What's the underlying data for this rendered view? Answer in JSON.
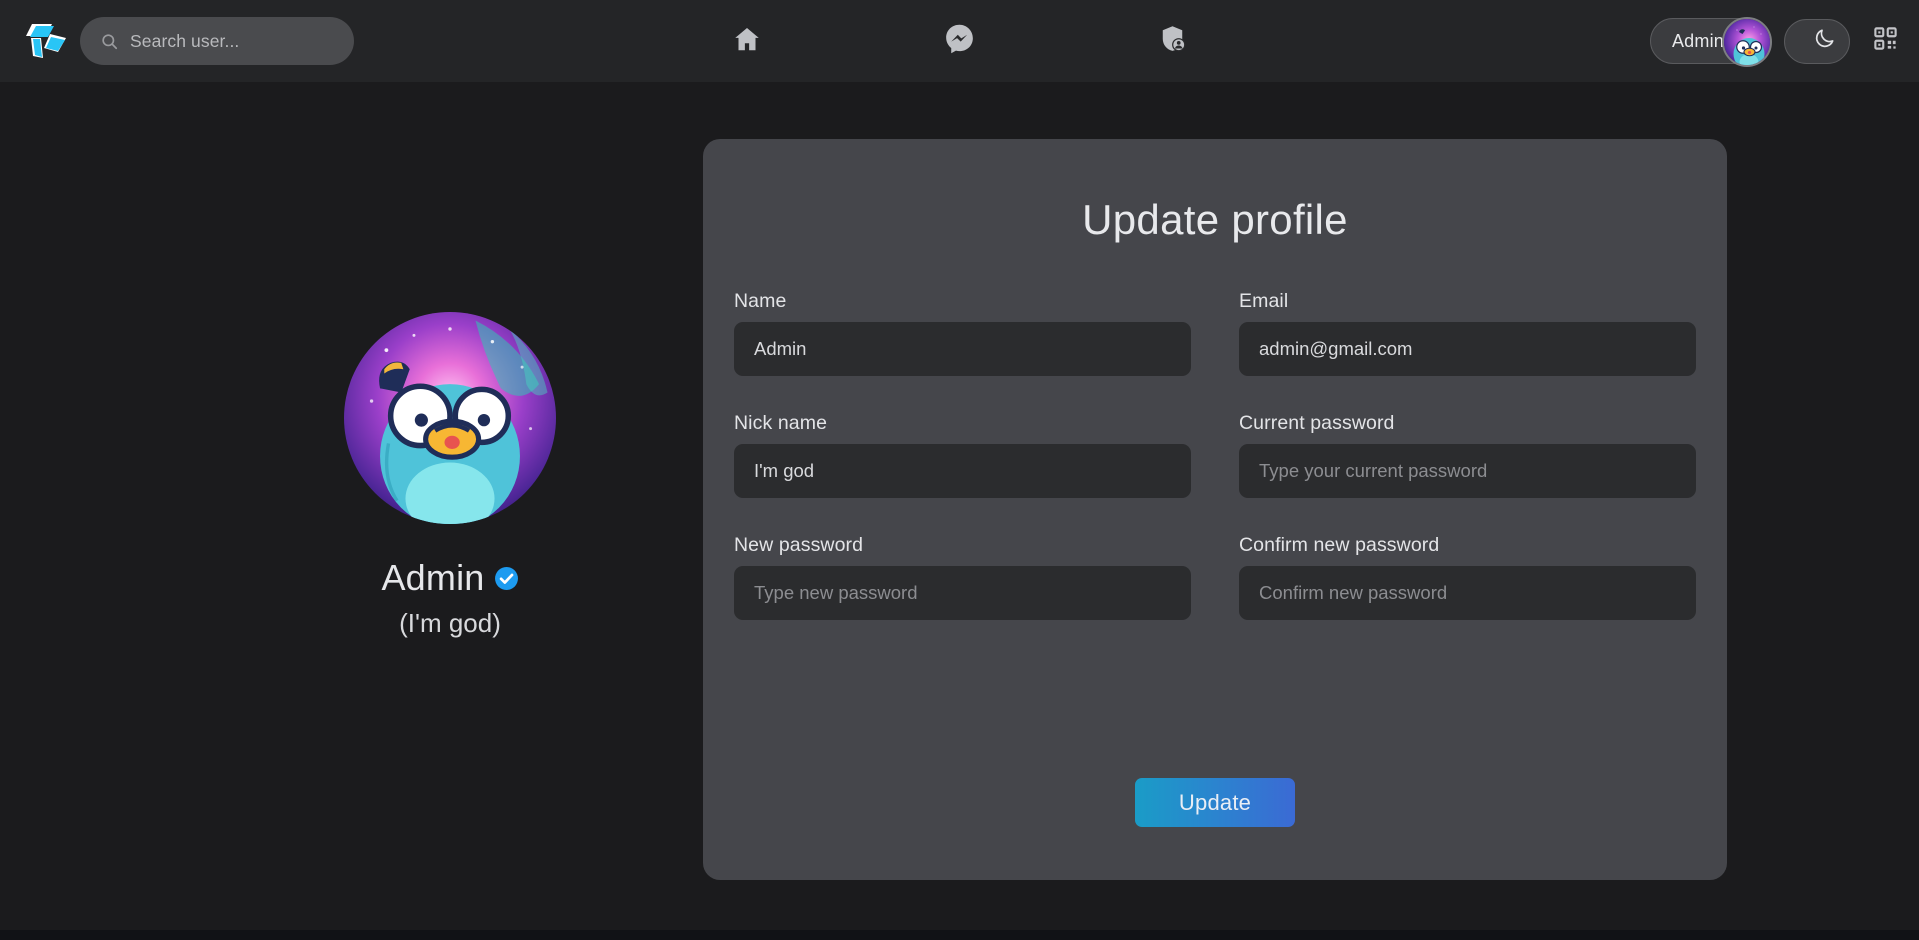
{
  "header": {
    "logo_name": "app-logo",
    "search": {
      "placeholder": "Search user...",
      "value": "",
      "icon": "search-icon"
    },
    "nav": [
      {
        "name": "home",
        "icon": "home-icon",
        "label": "Home"
      },
      {
        "name": "messages",
        "icon": "messenger-icon",
        "label": "Messages"
      },
      {
        "name": "admin",
        "icon": "shield-user-icon",
        "label": "Admin"
      }
    ],
    "user_pill": {
      "name": "Admin",
      "avatar_icon": "gopher-avatar"
    },
    "theme_toggle": {
      "icon": "moon-icon",
      "state": "dark"
    },
    "qr_button": {
      "icon": "qr-code-icon"
    }
  },
  "profile": {
    "avatar_icon": "gopher-avatar-large",
    "name": "Admin",
    "verified_icon": "verified-badge-icon",
    "nickname": "(I'm god)"
  },
  "card": {
    "title": "Update profile",
    "fields": [
      {
        "name": "name",
        "label": "Name",
        "value": "Admin",
        "placeholder": "",
        "type": "text"
      },
      {
        "name": "email",
        "label": "Email",
        "value": "admin@gmail.com",
        "placeholder": "",
        "type": "text"
      },
      {
        "name": "nickname",
        "label": "Nick name",
        "value": "I'm god",
        "placeholder": "",
        "type": "text"
      },
      {
        "name": "current-password",
        "label": "Current password",
        "value": "",
        "placeholder": "Type your current password",
        "type": "password"
      },
      {
        "name": "new-password",
        "label": "New password",
        "value": "",
        "placeholder": "Type new password",
        "type": "password"
      },
      {
        "name": "confirm-password",
        "label": "Confirm new password",
        "value": "",
        "placeholder": "Confirm new password",
        "type": "password"
      }
    ],
    "submit_label": "Update"
  },
  "colors": {
    "page_bg": "#1b1b1d",
    "header_bg": "#242527",
    "card_bg": "#45464b",
    "input_bg": "#2b2c2e",
    "accent_cyan": "#1a9cc7",
    "accent_blue": "#3b6ad4",
    "verified_blue": "#1d9bf0",
    "logo_cyan": "#29c5f6"
  }
}
